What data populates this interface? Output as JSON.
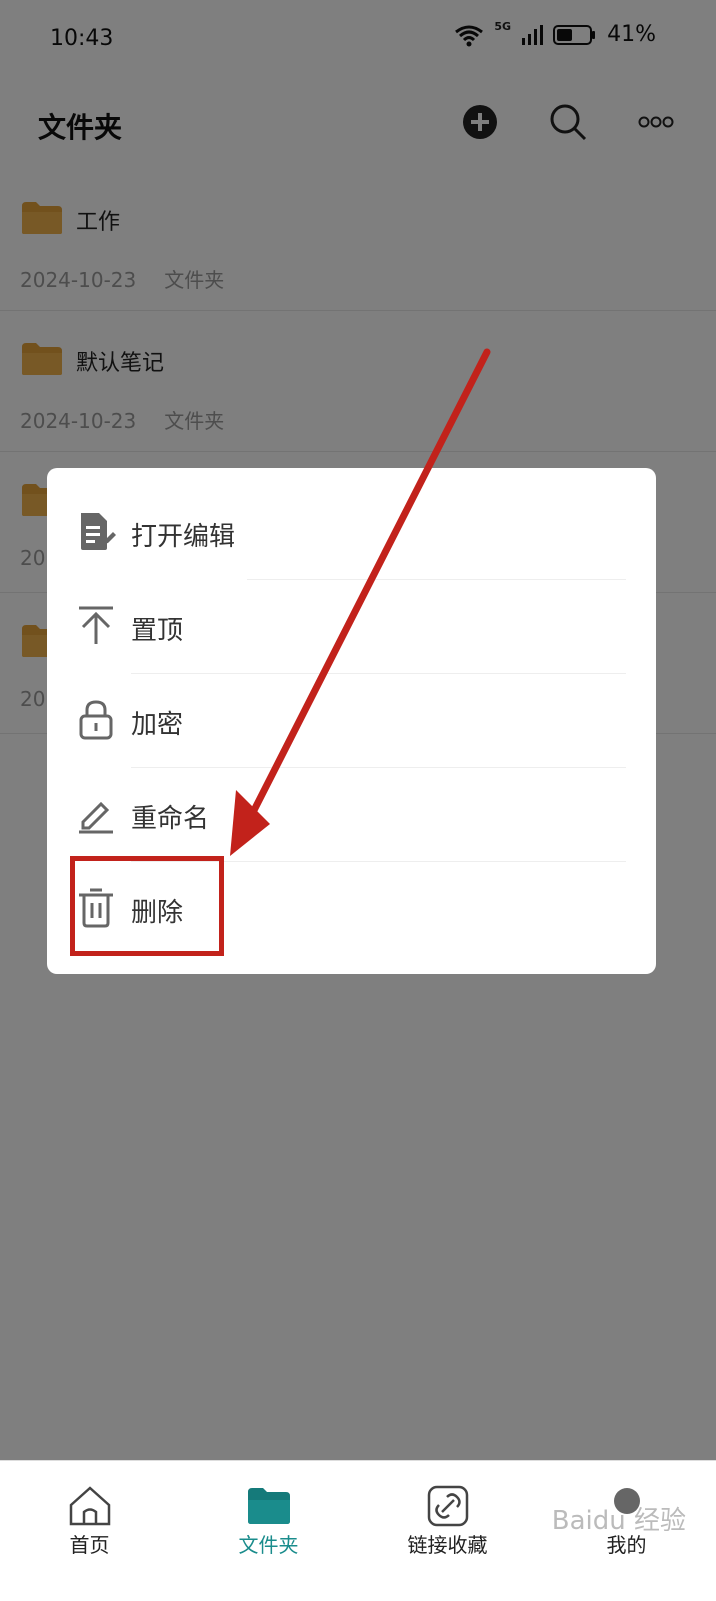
{
  "status_bar": {
    "time": "10:43",
    "network": "5G",
    "battery": "41%"
  },
  "app_bar": {
    "title": "文件夹",
    "icons": [
      "add-icon",
      "search-icon",
      "more-icon"
    ]
  },
  "folders": [
    {
      "name": "工作",
      "date": "2024-10-23",
      "type": "文件夹"
    },
    {
      "name": "默认笔记",
      "date": "2024-10-23",
      "type": "文件夹"
    },
    {
      "name": "",
      "date": "20",
      "type": ""
    },
    {
      "name": "",
      "date": "20",
      "type": ""
    }
  ],
  "context_menu": {
    "items": [
      {
        "label": "打开编辑",
        "icon": "edit-document-icon"
      },
      {
        "label": "置顶",
        "icon": "pin-top-icon"
      },
      {
        "label": "加密",
        "icon": "lock-icon"
      },
      {
        "label": "重命名",
        "icon": "rename-icon"
      },
      {
        "label": "删除",
        "icon": "trash-icon"
      }
    ]
  },
  "tabs": [
    {
      "label": "首页",
      "icon": "home-icon"
    },
    {
      "label": "文件夹",
      "icon": "folder-icon",
      "active": true
    },
    {
      "label": "链接收藏",
      "icon": "link-icon"
    },
    {
      "label": "我的",
      "icon": "profile-icon"
    }
  ],
  "watermark": "Baidu 经验",
  "colors": {
    "accent": "#1a8c8c",
    "folder": "#e5a23a",
    "annotation": "#c2221b"
  }
}
